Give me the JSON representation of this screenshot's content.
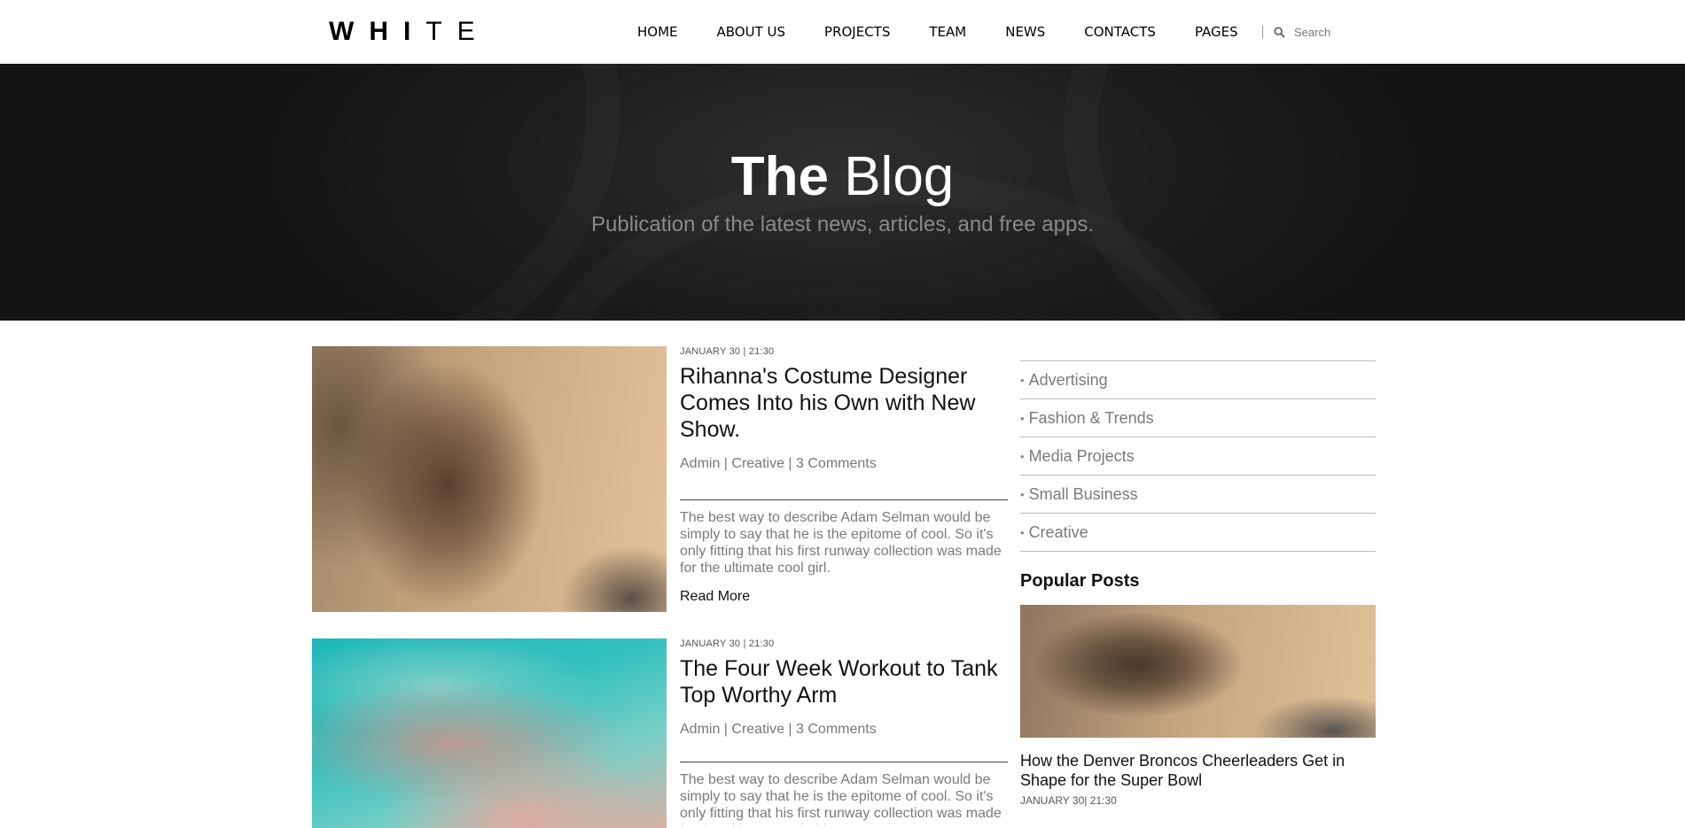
{
  "header": {
    "logo_bold": "WHI",
    "logo_light": "TE",
    "nav": [
      "HOME",
      "ABOUT US",
      "PROJECTS",
      "TEAM",
      "NEWS",
      "CONTACTS",
      "PAGES"
    ],
    "search_placeholder": "Search"
  },
  "hero": {
    "title_strong": "The",
    "title_light": "Blog",
    "subtitle": "Publication of the latest news, articles, and free apps."
  },
  "posts": [
    {
      "date": "JANUARY 30 | 21:30",
      "title": "Rihanna's Costume Designer Comes Into his Own with New Show.",
      "byline": "Admin | Creative | 3 Comments",
      "excerpt": "The best way to describe Adam Selman would be simply to say that he is the epitome of cool. So it's only fitting that his first runway collection was made for the ultimate cool girl.",
      "read_more": "Read More"
    },
    {
      "date": "JANUARY 30 | 21:30",
      "title": "The Four Week Workout to Tank Top Worthy Arm",
      "byline": "Admin | Creative | 3 Comments",
      "excerpt": "The best way to describe Adam Selman would be simply to say that he is the epitome of cool. So it's only fitting that his first runway collection was made for the ultimate cool girl."
    }
  ],
  "sidebar": {
    "categories": [
      "Advertising",
      "Fashion & Trends",
      "Media Projects",
      "Small Business",
      "Creative"
    ],
    "popular_title_bold": "Popular",
    "popular_title_light": "Posts",
    "popular_post": {
      "title": "How the Denver Broncos Cheerleaders Get in Shape for the Super Bowl",
      "date": "JANUARY 30| 21:30"
    }
  },
  "colors": {
    "hero_bg": "#1e1e1e",
    "text_muted": "#7a7a7a",
    "accent_text": "#111111"
  }
}
